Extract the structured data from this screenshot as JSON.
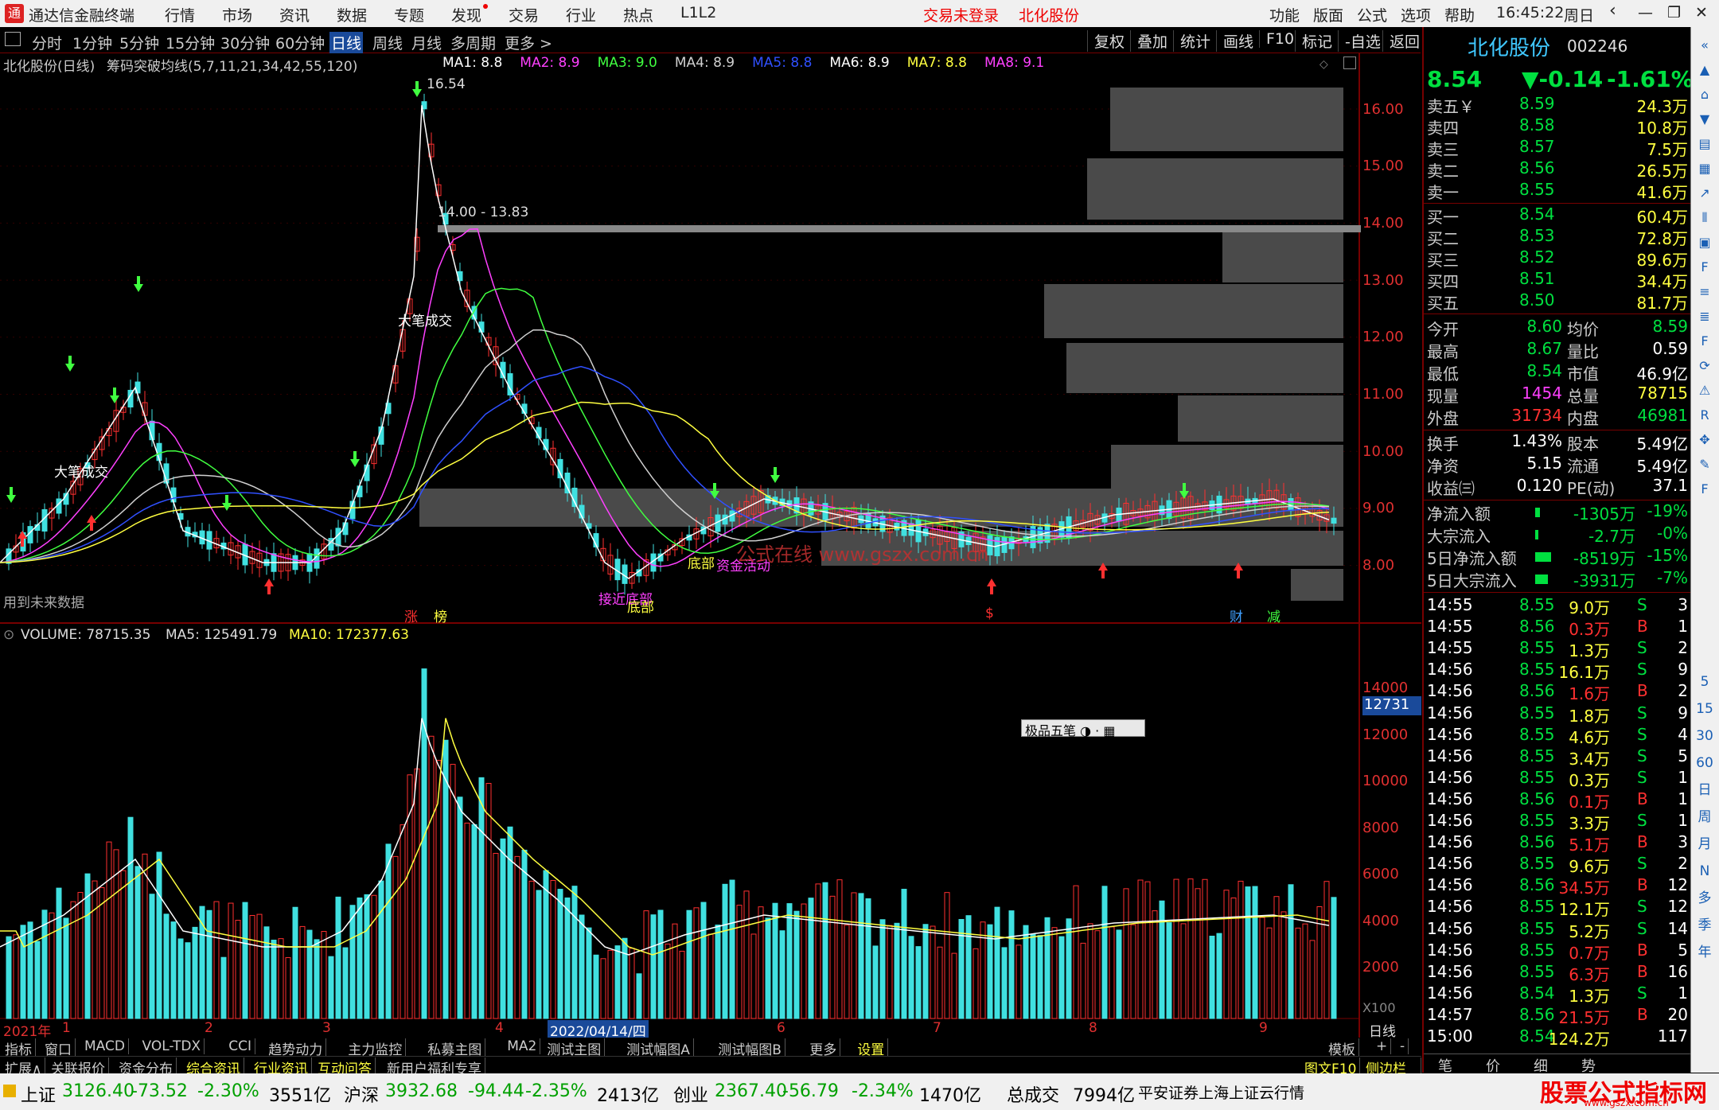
{
  "titlebar": {
    "app_name": "通达信金融终端",
    "menu": [
      "行情",
      "市场",
      "资讯",
      "数据",
      "专题",
      "发现",
      "交易",
      "行业",
      "热点",
      "L1L2"
    ],
    "login_status": "交易未登录",
    "stock_name": "北化股份",
    "right_menu": [
      "功能",
      "版面",
      "公式",
      "选项",
      "帮助"
    ],
    "time": "16:45:22",
    "weekday": "周日"
  },
  "toolbar": {
    "periods": [
      "分时",
      "1分钟",
      "5分钟",
      "15分钟",
      "30分钟",
      "60分钟",
      "日线",
      "周线",
      "月线",
      "多周期",
      "更多 >"
    ],
    "active": "日线",
    "right": [
      "复权",
      "叠加",
      "统计",
      "画线",
      "F10",
      "标记",
      "-自选",
      "返回"
    ]
  },
  "chart_header": {
    "stock_title": "北化股份(日线)",
    "indicator": "筹码突破均线(5,7,11,21,34,42,55,120)",
    "ma": [
      {
        "label": "MA1: 8.8",
        "color": "#ffffff"
      },
      {
        "label": "MA2: 8.9",
        "color": "#ff40ff"
      },
      {
        "label": "MA3: 9.0",
        "color": "#40ff40"
      },
      {
        "label": "MA4: 8.9",
        "color": "#d0d0d0"
      },
      {
        "label": "MA5: 8.8",
        "color": "#3050ff"
      },
      {
        "label": "MA6: 8.9",
        "color": "#ffffff"
      },
      {
        "label": "MA7: 8.8",
        "color": "#ffff40"
      },
      {
        "label": "MA8: 9.1",
        "color": "#ff40ff"
      }
    ]
  },
  "price_axis": [
    "16.00",
    "15.00",
    "14.00",
    "13.00",
    "12.00",
    "11.00",
    "10.00",
    "9.00",
    "8.00"
  ],
  "annotations": {
    "high": "16.54",
    "range": "14.00 - 13.83",
    "big_trade_1": "大笔成交",
    "big_trade_2": "大笔成交",
    "near_bottom": "接近底部",
    "bottom1": "底部",
    "bottom2": "底部",
    "fund_active": "资金活动",
    "watermark": "公式在线 www.gszx.com.cn",
    "future_data": "用到未来数据",
    "markers": [
      "涨",
      "榜",
      "$",
      "财",
      "减"
    ]
  },
  "volume_header": {
    "label": "VOLUME: 78715.35",
    "ma5": "MA5: 125491.79",
    "ma10": "MA10: 172377.63"
  },
  "volume_axis": [
    "14000",
    "12000",
    "10000",
    "8000",
    "6000",
    "4000",
    "2000"
  ],
  "volume_cursor": "12731",
  "volume_unit": "X100",
  "float_toolbar": "极品五笔",
  "date_axis": {
    "year": "2021年",
    "months": [
      "1",
      "2",
      "3",
      "4",
      "6",
      "7",
      "8",
      "9"
    ],
    "selected": "2022/04/14/四",
    "period": "日线"
  },
  "bottom_tabs": [
    "指标",
    "窗口",
    "MACD",
    "VOL-TDX",
    "CCI",
    "趋势动力",
    "主力监控",
    "私募主图",
    "MA2",
    "测试主图",
    "测试幅图A",
    "测试幅图B",
    "更多",
    "设置"
  ],
  "bottom_tabs_right": [
    "模板",
    "+",
    "-"
  ],
  "bottom_tabs2": [
    "扩展∧",
    "关联报价",
    "资金分布",
    "综合资讯",
    "行业资讯",
    "互动问答",
    "新用户福利专享"
  ],
  "bottom_tabs2_right": [
    "图文F10",
    "侧边栏《"
  ],
  "right_panel": {
    "name": "北化股份",
    "code": "002246",
    "price": "8.54",
    "change": "▼-0.14",
    "pct": "-1.61%",
    "asks": [
      {
        "label": "卖五￥",
        "price": "8.59",
        "vol": "24.3万"
      },
      {
        "label": "卖四",
        "price": "8.58",
        "vol": "10.8万"
      },
      {
        "label": "卖三",
        "price": "8.57",
        "vol": "7.5万"
      },
      {
        "label": "卖二",
        "price": "8.56",
        "vol": "26.5万"
      },
      {
        "label": "卖一",
        "price": "8.55",
        "vol": "41.6万"
      }
    ],
    "bids": [
      {
        "label": "买一",
        "price": "8.54",
        "vol": "60.4万"
      },
      {
        "label": "买二",
        "price": "8.53",
        "vol": "72.8万"
      },
      {
        "label": "买三",
        "price": "8.52",
        "vol": "89.6万"
      },
      {
        "label": "买四",
        "price": "8.51",
        "vol": "34.4万"
      },
      {
        "label": "买五",
        "price": "8.50",
        "vol": "81.7万"
      }
    ],
    "stats": [
      {
        "l1": "今开",
        "v1": "8.60",
        "l2": "均价",
        "v2": "8.59"
      },
      {
        "l1": "最高",
        "v1": "8.67",
        "l2": "量比",
        "v2": "0.59"
      },
      {
        "l1": "最低",
        "v1": "8.54",
        "l2": "市值",
        "v2": "46.9亿"
      },
      {
        "l1": "现量",
        "v1": "1454",
        "l2": "总量",
        "v2": "78715"
      },
      {
        "l1": "外盘",
        "v1": "31734",
        "l2": "内盘",
        "v2": "46981"
      }
    ],
    "fin": [
      {
        "l1": "换手",
        "v1": "1.43%",
        "l2": "股本",
        "v2": "5.49亿"
      },
      {
        "l1": "净资",
        "v1": "5.15",
        "l2": "流通",
        "v2": "5.49亿"
      },
      {
        "l1": "收益㈢",
        "v1": "0.120",
        "l2": "PE(动)",
        "v2": "37.1"
      }
    ],
    "flows": [
      {
        "l": "净流入额",
        "v": "-1305万",
        "p": "-19%"
      },
      {
        "l": "大宗流入",
        "v": "-2.7万",
        "p": "-0%"
      },
      {
        "l": "5日净流入额",
        "v": "-8519万",
        "p": "-15%"
      },
      {
        "l": "5日大宗流入",
        "v": "-3931万",
        "p": "-7%"
      }
    ],
    "ticks": [
      [
        "14:55",
        "8.55",
        "9.0万",
        "S",
        "3"
      ],
      [
        "14:55",
        "8.56",
        "0.3万",
        "B",
        "1"
      ],
      [
        "14:55",
        "8.55",
        "1.3万",
        "S",
        "2"
      ],
      [
        "14:56",
        "8.55",
        "16.1万",
        "S",
        "9"
      ],
      [
        "14:56",
        "8.56",
        "1.6万",
        "B",
        "2"
      ],
      [
        "14:56",
        "8.55",
        "1.8万",
        "S",
        "9"
      ],
      [
        "14:56",
        "8.55",
        "4.6万",
        "S",
        "4"
      ],
      [
        "14:56",
        "8.55",
        "3.4万",
        "S",
        "5"
      ],
      [
        "14:56",
        "8.55",
        "0.3万",
        "S",
        "1"
      ],
      [
        "14:56",
        "8.56",
        "0.1万",
        "B",
        "1"
      ],
      [
        "14:56",
        "8.55",
        "3.3万",
        "S",
        "1"
      ],
      [
        "14:56",
        "8.56",
        "5.1万",
        "B",
        "3"
      ],
      [
        "14:56",
        "8.55",
        "9.6万",
        "S",
        "2"
      ],
      [
        "14:56",
        "8.56",
        "34.5万",
        "B",
        "12"
      ],
      [
        "14:56",
        "8.55",
        "12.1万",
        "S",
        "12"
      ],
      [
        "14:56",
        "8.55",
        "5.2万",
        "S",
        "14"
      ],
      [
        "14:56",
        "8.55",
        "0.7万",
        "B",
        "5"
      ],
      [
        "14:56",
        "8.55",
        "6.3万",
        "B",
        "16"
      ],
      [
        "14:56",
        "8.54",
        "1.3万",
        "S",
        "1"
      ],
      [
        "14:57",
        "8.56",
        "21.5万",
        "B",
        "20"
      ],
      [
        "15:00",
        "8.54",
        "124.2万",
        "",
        "117"
      ]
    ],
    "bottom_tabs": [
      "笔",
      "价",
      "细",
      "势"
    ]
  },
  "side_icons": [
    "collapse-icon",
    "up-icon",
    "home-icon",
    "down-icon",
    "list-icon",
    "grid-icon",
    "chart-line-icon",
    "candle-icon",
    "report-icon",
    "f10-icon",
    "fund-icon",
    "fund2-icon",
    "f2-icon",
    "refresh-icon",
    "hot-icon",
    "rsi-icon",
    "move-icon",
    "pen-icon",
    "f5-icon"
  ],
  "side_labels": [
    "5",
    "15",
    "30",
    "60",
    "日",
    "周",
    "月",
    "N",
    "多",
    "季",
    "年"
  ],
  "statusbar": {
    "items": [
      {
        "name": "上证",
        "val": "3126.40",
        "chg": "-73.52",
        "pct": "-2.30%",
        "amt": "3551亿"
      },
      {
        "name": "沪深",
        "val": "3932.68",
        "chg": "-94.44",
        "pct": "-2.35%",
        "amt": "2413亿"
      },
      {
        "name": "创业",
        "val": "2367.40",
        "chg": "-56.79",
        "pct": "-2.34%",
        "amt": "1470亿"
      }
    ],
    "total_label": "总成交",
    "total": "7994亿",
    "broker": "平安证券上海上证云行情",
    "brand": "股票公式指标网",
    "brand_url": "www.gszx.com.cn"
  }
}
